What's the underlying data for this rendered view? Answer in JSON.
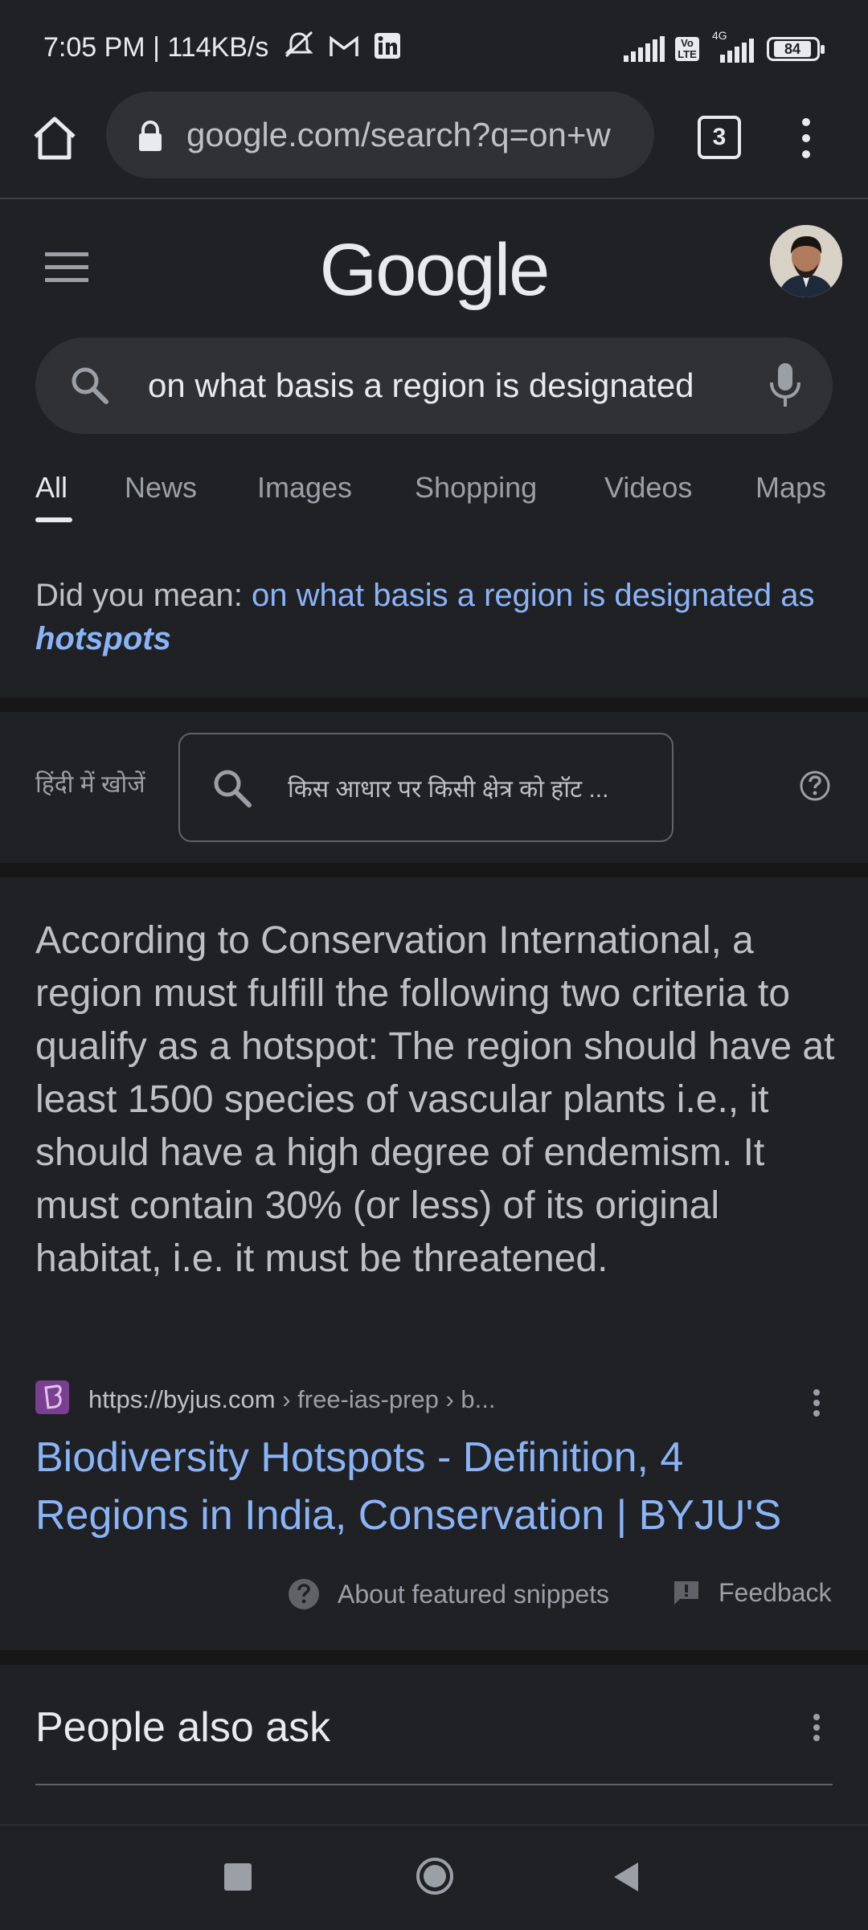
{
  "status_bar": {
    "time_speed": "7:05 PM | 114KB/s",
    "network": "4G",
    "volte": "Vo LTE",
    "battery": "84"
  },
  "browser": {
    "url": "google.com/search?q=on+w",
    "tab_count": "3"
  },
  "google": {
    "logo_text": "Google",
    "query": "on what basis a region is designated",
    "tabs": [
      "All",
      "News",
      "Images",
      "Shopping",
      "Videos",
      "Maps"
    ]
  },
  "did_you_mean": {
    "prefix": "Did you mean: ",
    "link_plain": "on what basis a region is designated as ",
    "link_emph": "hotspots"
  },
  "hindi": {
    "label": "हिंदी में खोजें",
    "query": "किस आधार पर किसी क्षेत्र को हॉट ..."
  },
  "snippet": {
    "text": "According to Conservation International, a region must fulfill the following two criteria to qualify as a hotspot: The region should have at least 1500 species of vascular plants i.e., it should have a high degree of endemism. It must contain 30% (or less) of its original habitat, i.e. it must be threatened.",
    "source_url": "https://byjus.com",
    "source_crumb": " › free-ias-prep › b...",
    "title": "Biodiversity Hotspots - Definition, 4 Regions in India, Conservation | BYJU'S",
    "about": "About featured snippets",
    "feedback": "Feedback"
  },
  "people_also_ask": {
    "heading": "People also ask"
  }
}
